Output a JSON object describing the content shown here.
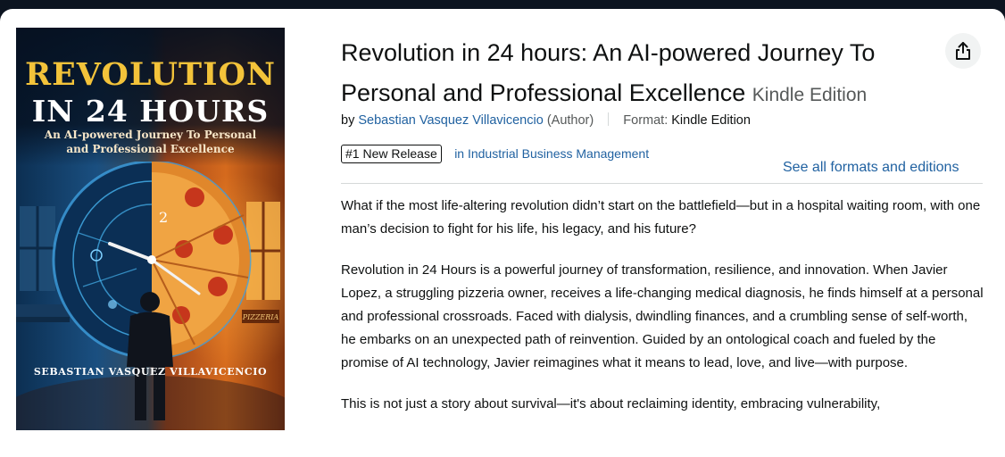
{
  "product": {
    "title": "Revolution in 24 hours: An AI-powered Journey To Personal and Professional Excellence",
    "edition": "Kindle Edition",
    "byline": {
      "by": "by",
      "author": "Sebastian Vasquez Villavicencio",
      "role": "(Author)",
      "format_label": "Format:",
      "format_value": "Kindle Edition"
    },
    "badge": "#1 New Release",
    "badge_category": "in Industrial Business Management",
    "see_all_formats": "See all formats and editions",
    "share_icon": "share-icon"
  },
  "cover": {
    "title_line1": "REVOLUTION",
    "title_line2": "IN 24 HOURS",
    "subtitle_line1": "An AI-powered Journey To Personal",
    "subtitle_line2": "and Professional Excellence",
    "clock_number": "2",
    "sign_text": "PIZZERIA",
    "author": "SEBASTIAN VASQUEZ VILLAVICENCIO"
  },
  "description": {
    "paragraphs": [
      "What if the most life-altering revolution didn’t start on the battlefield—but in a hospital waiting room, with one man’s decision to fight for his life, his legacy, and his future?",
      "Revolution in 24 Hours is a powerful journey of transformation, resilience, and innovation. When Javier Lopez, a struggling pizzeria owner, receives a life-changing medical diagnosis, he finds himself at a personal and professional crossroads. Faced with dialysis, dwindling finances, and a crumbling sense of self-worth, he embarks on an unexpected path of reinvention. Guided by an ontological coach and fueled by the promise of AI technology, Javier reimagines what it means to lead, love, and live—with purpose.",
      "This is not just a story about survival—it's about reclaiming identity, embracing vulnerability,"
    ]
  },
  "colors": {
    "link": "#2162a1",
    "text": "#0f1111",
    "muted": "#565959",
    "cover_title": "#f3c33a"
  }
}
